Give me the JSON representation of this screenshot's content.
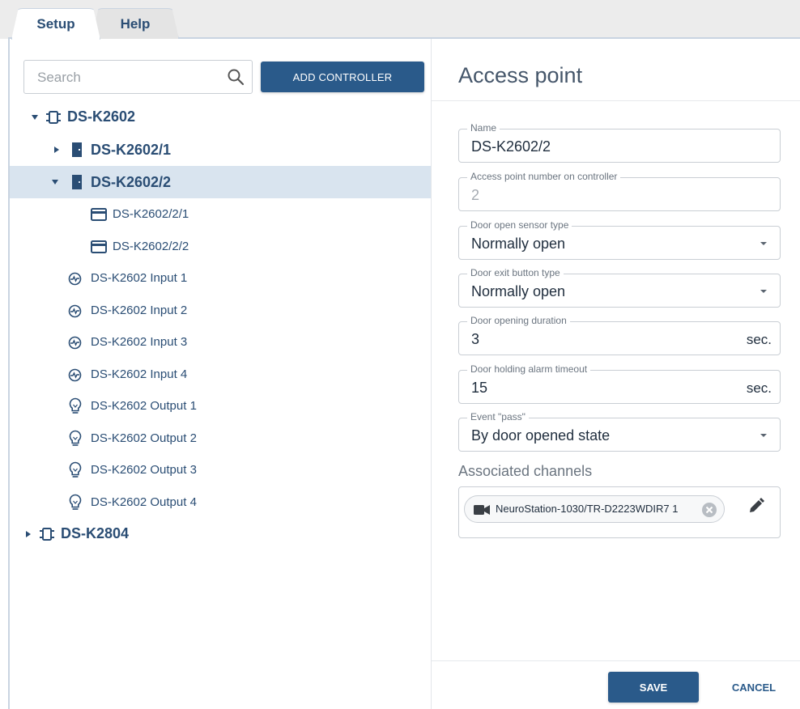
{
  "tabs": [
    {
      "label": "Setup",
      "active": true
    },
    {
      "label": "Help",
      "active": false
    }
  ],
  "search": {
    "placeholder": "Search",
    "value": ""
  },
  "add_controller_label": "ADD CONTROLLER",
  "tree": {
    "controller1": {
      "label": "DS-K2602",
      "expanded": true
    },
    "ap1": {
      "label": "DS-K2602/1",
      "expanded": false
    },
    "ap2": {
      "label": "DS-K2602/2",
      "expanded": true,
      "selected": true
    },
    "reader1": {
      "label": "DS-K2602/2/1"
    },
    "reader2": {
      "label": "DS-K2602/2/2"
    },
    "inputs": [
      "DS-K2602 Input 1",
      "DS-K2602 Input 2",
      "DS-K2602 Input 3",
      "DS-K2602 Input 4"
    ],
    "outputs": [
      "DS-K2602 Output 1",
      "DS-K2602 Output 2",
      "DS-K2602 Output 3",
      "DS-K2602 Output 4"
    ],
    "controller2": {
      "label": "DS-K2804",
      "expanded": false
    }
  },
  "panel": {
    "title": "Access point",
    "fields": {
      "name": {
        "label": "Name",
        "value": "DS-K2602/2"
      },
      "ap_number": {
        "label": "Access point number on controller",
        "value": "2"
      },
      "door_sensor": {
        "label": "Door open sensor type",
        "value": "Normally open"
      },
      "exit_button": {
        "label": "Door exit button type",
        "value": "Normally open"
      },
      "opening_duration": {
        "label": "Door opening duration",
        "value": "3",
        "unit": "sec."
      },
      "holding_timeout": {
        "label": "Door holding alarm timeout",
        "value": "15",
        "unit": "sec."
      },
      "event_pass": {
        "label": "Event \"pass\"",
        "value": "By door opened state"
      }
    },
    "associated_channels_label": "Associated channels",
    "channels": [
      {
        "name": "NeuroStation-1030/TR-D2223WDIR7 1"
      }
    ],
    "save_label": "SAVE",
    "cancel_label": "CANCEL"
  },
  "colors": {
    "primary": "#2a5a8a",
    "tree_text": "#2a4d74",
    "selected_row": "#d9e4ef"
  }
}
